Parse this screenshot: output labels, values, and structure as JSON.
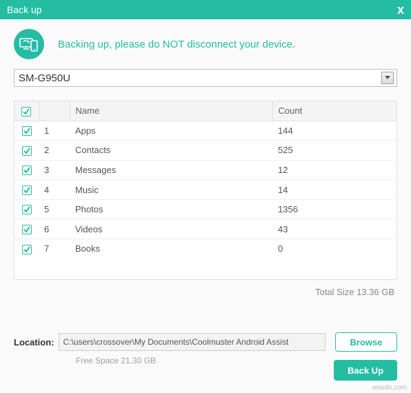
{
  "titlebar": {
    "title": "Back up"
  },
  "banner": {
    "text": "Backing up, please do NOT disconnect your device."
  },
  "device": {
    "selected": "SM-G950U"
  },
  "table": {
    "headers": {
      "name": "Name",
      "count": "Count"
    },
    "rows": [
      {
        "idx": "1",
        "name": "Apps",
        "count": "144",
        "checked": true
      },
      {
        "idx": "2",
        "name": "Contacts",
        "count": "525",
        "checked": true
      },
      {
        "idx": "3",
        "name": "Messages",
        "count": "12",
        "checked": true
      },
      {
        "idx": "4",
        "name": "Music",
        "count": "14",
        "checked": true
      },
      {
        "idx": "5",
        "name": "Photos",
        "count": "1356",
        "checked": true
      },
      {
        "idx": "6",
        "name": "Videos",
        "count": "43",
        "checked": true
      },
      {
        "idx": "7",
        "name": "Books",
        "count": "0",
        "checked": true
      }
    ],
    "select_all_checked": true
  },
  "summary": {
    "total_size": "Total Size 13.36 GB"
  },
  "location": {
    "label": "Location:",
    "path": "C:\\users\\crossover\\My Documents\\Coolmuster Android Assist",
    "browse_label": "Browse",
    "free_space": "Free Space 21.30 GB"
  },
  "actions": {
    "backup_label": "Back Up"
  },
  "watermark": "wsxdn.com",
  "colors": {
    "accent": "#25bca4"
  }
}
